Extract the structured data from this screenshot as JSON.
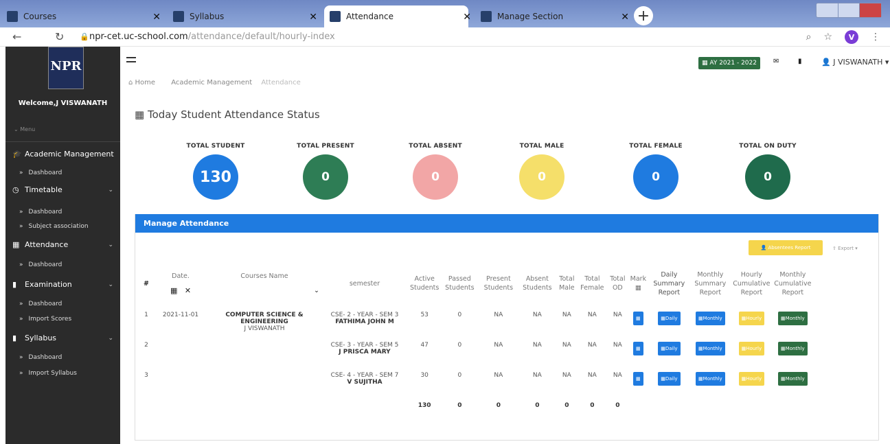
{
  "browser": {
    "tabs": [
      {
        "title": "Courses"
      },
      {
        "title": "Syllabus"
      },
      {
        "title": "Attendance"
      },
      {
        "title": "Manage Section"
      }
    ],
    "url_host": "npr-cet.uc-school.com",
    "url_path": "/attendance/default/hourly-index",
    "avatar_letter": "V"
  },
  "sidebar": {
    "logo_text": "NPR",
    "welcome": "Welcome,J VISWANATH",
    "menu_toggle": "Menu",
    "sections": [
      {
        "label": "Academic Management",
        "items": [
          "Dashboard"
        ]
      },
      {
        "label": "Timetable",
        "items": [
          "Dashboard",
          "Subject association"
        ]
      },
      {
        "label": "Attendance",
        "items": [
          "Dashboard"
        ]
      },
      {
        "label": "Examination",
        "items": [
          "Dashboard",
          "Import Scores"
        ]
      },
      {
        "label": "Syllabus",
        "items": [
          "Dashboard",
          "Import Syllabus"
        ]
      }
    ]
  },
  "header": {
    "ay_badge": "AY 2021 - 2022",
    "user": "J VISWANATH"
  },
  "breadcrumb": [
    "Home",
    "Academic Management",
    "Attendance"
  ],
  "page_title": "Today Student Attendance Status",
  "stats": [
    {
      "label": "TOTAL STUDENT",
      "value": "130",
      "color": "#1f7be0"
    },
    {
      "label": "TOTAL PRESENT",
      "value": "0",
      "color": "#2e7d55"
    },
    {
      "label": "TOTAL ABSENT",
      "value": "0",
      "color": "#f2a6a6"
    },
    {
      "label": "TOTAL MALE",
      "value": "0",
      "color": "#f5df6a"
    },
    {
      "label": "TOTAL FEMALE",
      "value": "0",
      "color": "#1f7be0"
    },
    {
      "label": "TOTAL ON DUTY",
      "value": "0",
      "color": "#1f6b4c"
    }
  ],
  "panel": {
    "title": "Manage Attendance",
    "absentees_button": "Absentees Report",
    "export_button": "Export"
  },
  "table": {
    "headers": [
      "#",
      "Date.",
      "Courses Name",
      "semester",
      "Active Students",
      "Passed Students",
      "Present Students",
      "Absent Students",
      "Total Male",
      "Total Female",
      "Total OD",
      "Mark",
      "Daily Summary Report",
      "Monthly Summary Report",
      "Hourly Cumulative Report",
      "Monthly Cumulative Report"
    ],
    "rows": [
      {
        "n": "1",
        "date": "2021-11-01",
        "course": "COMPUTER SCIENCE & ENGINEERING",
        "course_staff": "J VISWANATH",
        "sem": "CSE- 2 - YEAR - SEM 3",
        "staff": "FATHIMA JOHN M",
        "active": "53",
        "passed": "0",
        "present": "NA",
        "absent": "NA",
        "male": "NA",
        "female": "NA",
        "od": "NA"
      },
      {
        "n": "2",
        "date": "",
        "course": "",
        "course_staff": "",
        "sem": "CSE- 3 - YEAR - SEM 5",
        "staff": "J PRISCA MARY",
        "active": "47",
        "passed": "0",
        "present": "NA",
        "absent": "NA",
        "male": "NA",
        "female": "NA",
        "od": "NA"
      },
      {
        "n": "3",
        "date": "",
        "course": "",
        "course_staff": "",
        "sem": "CSE- 4 - YEAR - SEM 7",
        "staff": "V SUJITHA",
        "active": "30",
        "passed": "0",
        "present": "NA",
        "absent": "NA",
        "male": "NA",
        "female": "NA",
        "od": "NA"
      }
    ],
    "buttons": {
      "daily": "Daily",
      "monthly": "Monthly",
      "hourly": "Hourly"
    },
    "totals": [
      "130",
      "0",
      "0",
      "0",
      "0",
      "0",
      "0"
    ]
  }
}
